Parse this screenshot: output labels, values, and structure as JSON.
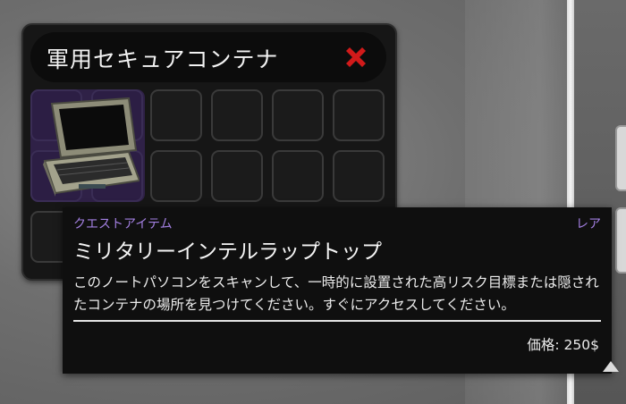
{
  "container": {
    "title": "軍用セキュアコンテナ",
    "close_icon": "close-x-icon",
    "close_color": "#d11a1a",
    "slot_color": "#2f2147"
  },
  "item": {
    "icon": "laptop-icon",
    "category": "クエストアイテム",
    "rarity": "レア",
    "name": "ミリタリーインテルラップトップ",
    "description": "このノートパソコンをスキャンして、一時的に設置された高リスク目標または隠されたコンテナの場所を見つけてください。すぐにアクセスしてください。",
    "price": "価格: 250$",
    "accent_color": "#a27fe0"
  }
}
